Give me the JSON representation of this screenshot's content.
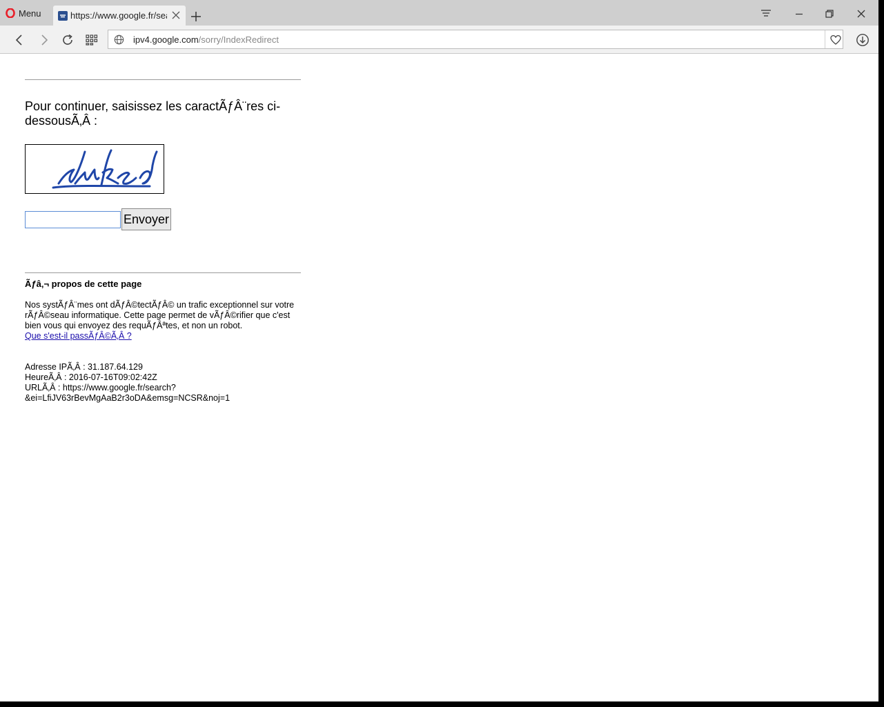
{
  "browser": {
    "menu_label": "Menu",
    "tab_title": "https://www.google.fr/search",
    "url_host": "ipv4.google.com",
    "url_path": "/sorry/IndexRedirect"
  },
  "page": {
    "prompt": "Pour continuer, saisissez les caractÃƒÂ¨res ci-dessousÃ‚Â :",
    "captcha_text": "dwuked",
    "input_value": "",
    "submit_label": "Envoyer",
    "about_heading": "Ãƒâ‚¬ propos de cette page",
    "about_body": "Nos systÃƒÂ¨mes ont dÃƒÂ©tectÃƒÂ© un trafic exceptionnel sur votre rÃƒÂ©seau informatique. Cette page permet de vÃƒÂ©rifier que c'est bien vous qui envoyez des requÃƒÂªtes, et non un robot.",
    "about_link": "Que s'est-il passÃƒÂ©Ã‚Â ?",
    "ip_line": "Adresse IPÃ‚Â : 31.187.64.129",
    "time_line": "HeureÃ‚Â : 2016-07-16T09:02:42Z",
    "url_line_1": "URLÃ‚Â : https://www.google.fr/search?",
    "url_line_2": "&ei=LfiJV63rBevMgAaB2r3oDA&emsg=NCSR&noj=1"
  },
  "colors": {
    "accent_blue": "#1a0dab",
    "captcha_ink": "#1f46a8",
    "opera_red": "#e8202a"
  }
}
